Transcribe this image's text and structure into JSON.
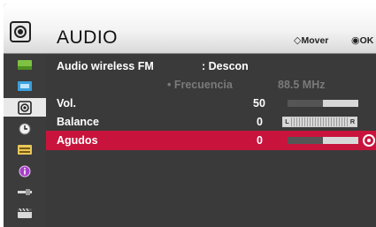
{
  "header": {
    "title": "AUDIO",
    "move_hint": "Mover",
    "ok_hint": "OK"
  },
  "sidebar": {
    "items": [
      {
        "icon": "picture-icon"
      },
      {
        "icon": "screen-icon"
      },
      {
        "icon": "audio-icon",
        "active": true
      },
      {
        "icon": "time-icon"
      },
      {
        "icon": "options-icon"
      },
      {
        "icon": "info-icon"
      },
      {
        "icon": "input-icon"
      },
      {
        "icon": "movie-icon"
      }
    ]
  },
  "menu": {
    "wireless": {
      "label": "Audio wireless FM",
      "value": ": Descon"
    },
    "frequency": {
      "label": "• Frecuencia",
      "value": "88.5 MHz"
    },
    "volume": {
      "label": "Vol.",
      "value": "50",
      "level": 0.5
    },
    "balance": {
      "label": "Balance",
      "value": "0",
      "left_tag": "L",
      "right_tag": "R"
    },
    "treble": {
      "label": "Agudos",
      "value": "0",
      "level": 0.5
    }
  },
  "colors": {
    "selected_row": "#c8143c",
    "panel": "#3a3a3a",
    "header": "#f3f3f3"
  }
}
